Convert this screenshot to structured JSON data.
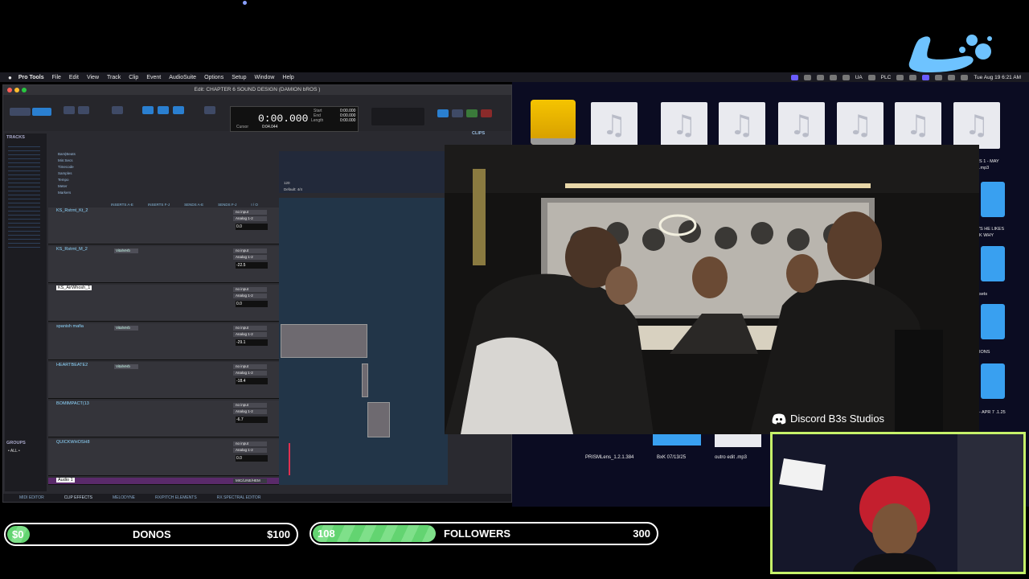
{
  "menubar": {
    "apple": "",
    "app": "Pro Tools",
    "menus": [
      "File",
      "Edit",
      "View",
      "Track",
      "Clip",
      "Event",
      "AudioSuite",
      "Options",
      "Setup",
      "Window",
      "Help"
    ],
    "status_left": "UA",
    "status_plc": "PLC",
    "datetime": "Tue Aug 19  6:21 AM"
  },
  "pt": {
    "title": "Edit: CHAPTER 6 SOUND DESIGN (DAMION bROS )",
    "counter_main": "0:00.000",
    "start_label": "Start",
    "end_label": "End",
    "length_label": "Length",
    "start_val": "0:00.000",
    "end_val": "0:00.000",
    "length_val": "0:00.000",
    "cursor_label": "Cursor",
    "cursor_val": "0:04.044",
    "tracks_header": "TRACKS",
    "groups_header": "GROUPS",
    "groups_item": "• ALL •",
    "clips_header": "CLIPS",
    "rulers": [
      "Bars|Beats",
      "Min:Secs",
      "Timecode",
      "Samples",
      "Tempo",
      "Meter",
      "Markers"
    ],
    "tempo_val": "120",
    "meter_val": "Default: 4/4",
    "col_headers": [
      "INSERTS A-E",
      "INSERTS F-J",
      "SENDS A-E",
      "SENDS F-J",
      "I / O"
    ],
    "tracks": [
      {
        "name": "KS_Rstrnt_Kt_2",
        "insert": "",
        "in": "no input",
        "out": "Analog 1-2",
        "vol": "0.0"
      },
      {
        "name": "KS_Rstrnt_M_2",
        "insert": "VitalVerb",
        "in": "no input",
        "out": "Analog 1-2",
        "vol": "-22.5"
      },
      {
        "name": "KS_AirWhosh_1",
        "insert": "",
        "in": "no input",
        "out": "Analog 1-2",
        "vol": "0.0"
      },
      {
        "name": "spanish mafia",
        "insert": "VitalVerb",
        "in": "no input",
        "out": "Analog 1-2",
        "vol": "-29.1"
      },
      {
        "name": "HEARTBEATE2",
        "insert": "VitalVerb",
        "in": "no input",
        "out": "Analog 1-2",
        "vol": "-18.4"
      },
      {
        "name": "BOMIMPACT(13",
        "insert": "",
        "in": "no input",
        "out": "Analog 1-2",
        "vol": "-6.7"
      },
      {
        "name": "QUICKWHOSH8",
        "insert": "",
        "in": "no input",
        "out": "Analog 1-2",
        "vol": "0.0"
      },
      {
        "name": "Audio 1",
        "insert": "",
        "in": "MIC/LINE/HEM",
        "out": "",
        "vol": ""
      }
    ],
    "bottom_tabs": [
      "MIDI EDITOR",
      "CLIP EFFECTS",
      "MELODYNE",
      "RX/PITCH ELEMENTS",
      "RX SPECTRAL EDITOR"
    ]
  },
  "desktop": {
    "file_labels": [
      "PRISMLens_1.2.1.384",
      "BxK 07/13/25",
      "outro edit .mp3"
    ],
    "side_labels": [
      "S 1 - MAY",
      ".mp3",
      "'S HE LIKES",
      "K WHY",
      "sets",
      "IONS",
      "- APR 7 .1.25"
    ]
  },
  "discord": {
    "label": "Discord B3s Studios"
  },
  "donos": {
    "current": "$0",
    "label": "DONOS",
    "goal": "$100",
    "progress": 0
  },
  "followers": {
    "current": "108",
    "label": "FOLLOWERS",
    "goal": "300",
    "progress": 0.36
  },
  "icons": {
    "music_note": "♫"
  },
  "colors": {
    "bar_green": "#63d471",
    "cam_border": "#c6f26a",
    "folder_blue": "#39a0f0"
  }
}
